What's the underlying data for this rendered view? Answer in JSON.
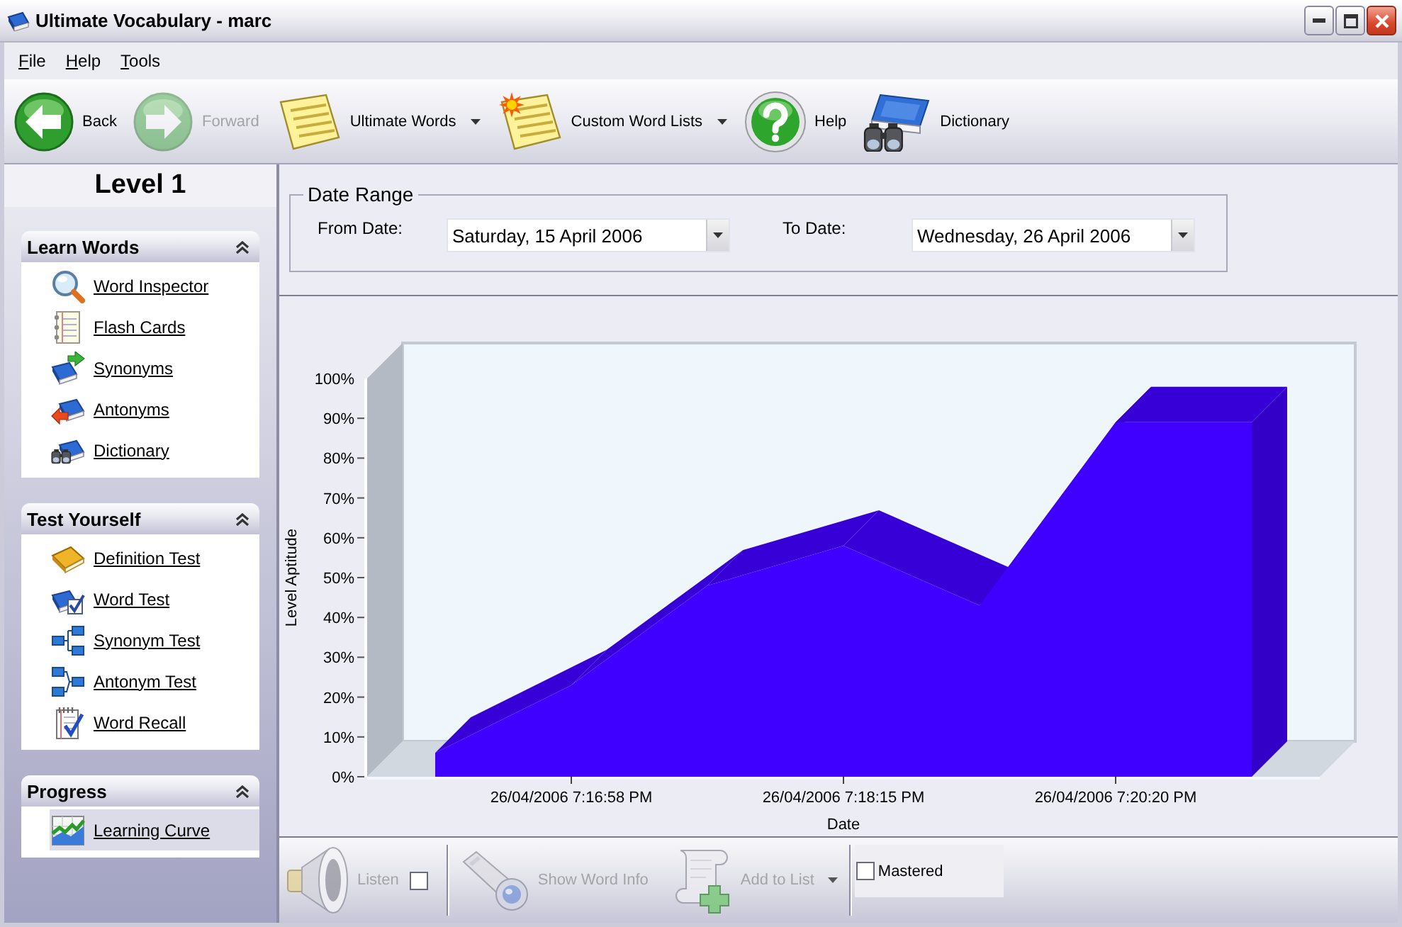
{
  "window": {
    "title": "Ultimate Vocabulary - marc"
  },
  "menu": [
    {
      "label": "File"
    },
    {
      "label": "Help"
    },
    {
      "label": "Tools"
    }
  ],
  "toolbar": [
    {
      "label": "Back",
      "disabled": false,
      "has_menu": false
    },
    {
      "label": "Forward",
      "disabled": true,
      "has_menu": false
    },
    {
      "label": "Ultimate Words",
      "disabled": false,
      "has_menu": true
    },
    {
      "label": "Custom Word Lists",
      "disabled": false,
      "has_menu": true
    },
    {
      "label": "Help",
      "disabled": false,
      "has_menu": false
    },
    {
      "label": "Dictionary",
      "disabled": false,
      "has_menu": false
    }
  ],
  "sidebar": {
    "title": "Level 1",
    "groups": [
      {
        "title": "Learn Words",
        "expanded": true,
        "items": [
          {
            "label": "Word Inspector",
            "selected": false
          },
          {
            "label": "Flash Cards",
            "selected": false
          },
          {
            "label": "Synonyms",
            "selected": false
          },
          {
            "label": "Antonyms",
            "selected": false
          },
          {
            "label": "Dictionary",
            "selected": false
          }
        ]
      },
      {
        "title": "Test Yourself",
        "expanded": true,
        "items": [
          {
            "label": "Definition Test",
            "selected": false
          },
          {
            "label": "Word Test",
            "selected": false
          },
          {
            "label": "Synonym Test",
            "selected": false
          },
          {
            "label": "Antonym Test",
            "selected": false
          },
          {
            "label": "Word Recall",
            "selected": false
          }
        ]
      },
      {
        "title": "Progress",
        "expanded": true,
        "items": [
          {
            "label": "Learning Curve",
            "selected": true
          }
        ]
      }
    ]
  },
  "date_range": {
    "title": "Date Range",
    "from": {
      "label": "From Date:",
      "value": "Saturday, 15 April 2006"
    },
    "to": {
      "label": "To Date:",
      "value": "Wednesday, 26 April 2006"
    }
  },
  "chart": {
    "chart_data": {
      "type": "area",
      "xlabel": "Date",
      "ylabel": "Level Aptitude",
      "categories": [
        null,
        "26/04/2006 7:16:58 PM",
        null,
        "26/04/2006 7:18:15 PM",
        null,
        "26/04/2006 7:20:20 PM",
        null
      ],
      "series": [
        {
          "color": "#4000ff",
          "values": [
            6,
            23,
            48,
            58,
            43,
            89,
            89
          ]
        }
      ],
      "ylim": [
        0,
        100
      ],
      "yticks": [
        {
          "value": 0,
          "label": "0%"
        },
        {
          "value": 10,
          "label": "10%"
        },
        {
          "value": 20,
          "label": "20%"
        },
        {
          "value": 30,
          "label": "30%"
        },
        {
          "value": 40,
          "label": "40%"
        },
        {
          "value": 50,
          "label": "50%"
        },
        {
          "value": 60,
          "label": "60%"
        },
        {
          "value": 70,
          "label": "70%"
        },
        {
          "value": 80,
          "label": "80%"
        },
        {
          "value": 90,
          "label": "90%"
        },
        {
          "value": 100,
          "label": "100%"
        }
      ]
    }
  },
  "bottom_toolbar": {
    "listen": {
      "label": "Listen",
      "disabled": true
    },
    "listen_toggle": {
      "checked": false
    },
    "actions": [
      {
        "label": "Show Word Info",
        "disabled": true,
        "has_menu": false
      },
      {
        "label": "Add to List",
        "disabled": true,
        "has_menu": true
      }
    ],
    "mastered": {
      "label": "Mastered",
      "checked": false
    }
  }
}
